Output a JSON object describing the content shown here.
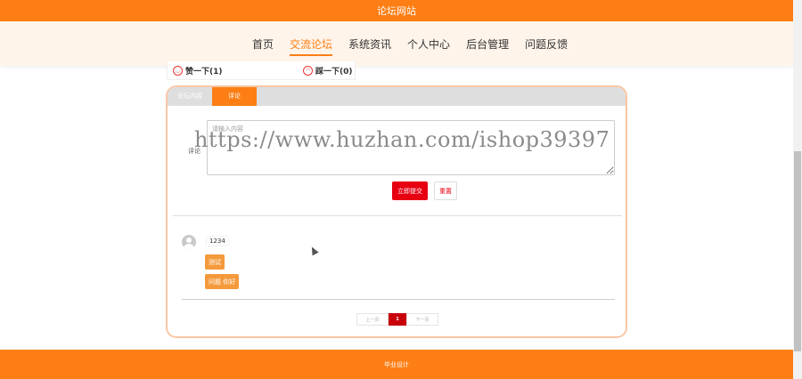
{
  "header": {
    "title": "论坛网站"
  },
  "nav": {
    "items": [
      {
        "label": "首页"
      },
      {
        "label": "交流论坛"
      },
      {
        "label": "系统资讯"
      },
      {
        "label": "个人中心"
      },
      {
        "label": "后台管理"
      },
      {
        "label": "问题反馈"
      }
    ],
    "active_index": 1
  },
  "votes": {
    "like": "赞一下(1)",
    "dislike": "踩一下(0)"
  },
  "tabs": [
    {
      "label": "论坛内容"
    },
    {
      "label": "评论"
    }
  ],
  "comment_form": {
    "label": "评论",
    "placeholder": "请输入内容",
    "submit_label": "立即提交",
    "reset_label": "重置"
  },
  "comments": [
    {
      "user": "1234",
      "tags": [
        "测试",
        "问题 你好"
      ]
    }
  ],
  "pagination": {
    "prev": "上一页",
    "current": "1",
    "next": "下一页"
  },
  "watermark": "https://www.huzhan.com/ishop39397",
  "footer": {
    "text": "毕业设计"
  },
  "colors": {
    "accent": "#fd7e14",
    "nav_bg": "#fff4ea",
    "submit": "#e60012",
    "page_current": "#c9000b",
    "tag": "#f59a3c"
  }
}
